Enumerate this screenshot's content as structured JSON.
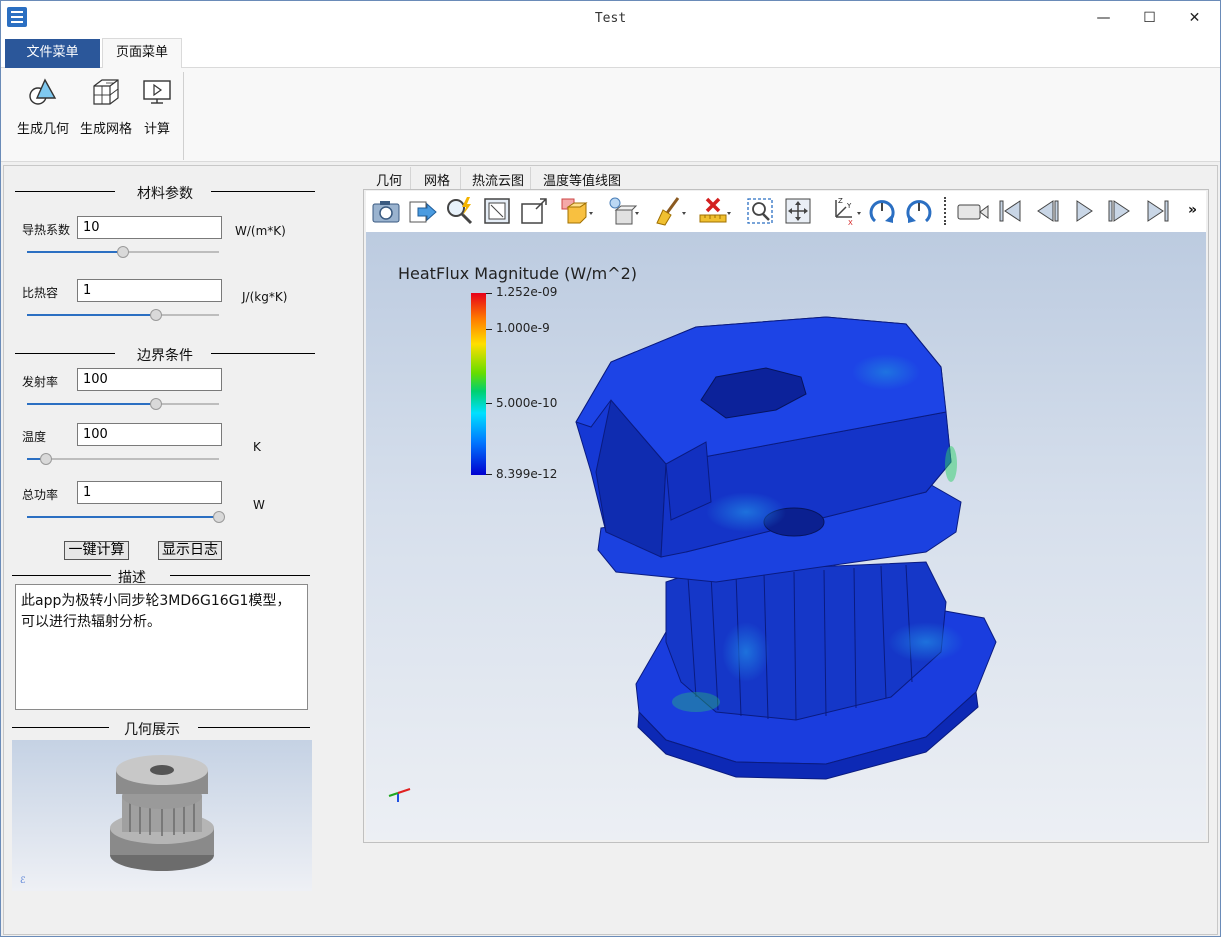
{
  "window": {
    "title": "Test",
    "minimize": "—",
    "maximize": "☐",
    "close": "✕"
  },
  "ribbon": {
    "tabs": [
      "文件菜单",
      "页面菜单"
    ],
    "buttons": [
      {
        "label": "生成几何",
        "icon": "geometry-icon"
      },
      {
        "label": "生成网格",
        "icon": "mesh-icon"
      },
      {
        "label": "计算",
        "icon": "compute-icon"
      }
    ]
  },
  "material": {
    "title": "材料参数",
    "conductivity": {
      "label": "导热系数",
      "value": "10",
      "unit": "W/(m*K)",
      "slider": 0.5
    },
    "specific_heat": {
      "label": "比热容",
      "value": "1",
      "unit": "J/(kg*K)",
      "slider": 0.67
    }
  },
  "boundary": {
    "title": "边界条件",
    "emissivity": {
      "label": "发射率",
      "value": "100",
      "unit": "",
      "slider": 0.67
    },
    "temperature": {
      "label": "温度",
      "value": "100",
      "unit": "K",
      "slider": 0.1
    },
    "power": {
      "label": "总功率",
      "value": "1",
      "unit": "W",
      "slider": 1.0
    }
  },
  "actions": {
    "compute": "一键计算",
    "log": "显示日志"
  },
  "description": {
    "title": "描述",
    "text": "此app为极转小同步轮3MD6G16G1模型，可以进行热辐射分析。"
  },
  "geometry_preview": {
    "title": "几何展示"
  },
  "view_tabs": [
    "几何",
    "网格",
    "热流云图",
    "温度等值线图"
  ],
  "toolbar_icons": [
    "camera-icon",
    "export-icon",
    "probe-icon",
    "fit-icon",
    "box-zoom-icon",
    "display-mode-icon",
    "light-icon",
    "clear-icon",
    "ruler-icon",
    "zoom-area-icon",
    "pan-icon",
    "axes-icon",
    "rotate-cw-icon",
    "rotate-ccw-icon",
    "record-icon",
    "first-frame-icon",
    "prev-frame-icon",
    "play-icon",
    "next-frame-icon",
    "last-frame-icon",
    "more-icon"
  ],
  "legend": {
    "title": "HeatFlux Magnitude (W/m^2)",
    "ticks": [
      "1.252e-09",
      "1.000e-9",
      "5.000e-10",
      "8.399e-12"
    ]
  },
  "colors": {
    "accent": "#2b579a",
    "slider": "#2b6fc2",
    "mesh_dominant": "#1230d0"
  }
}
